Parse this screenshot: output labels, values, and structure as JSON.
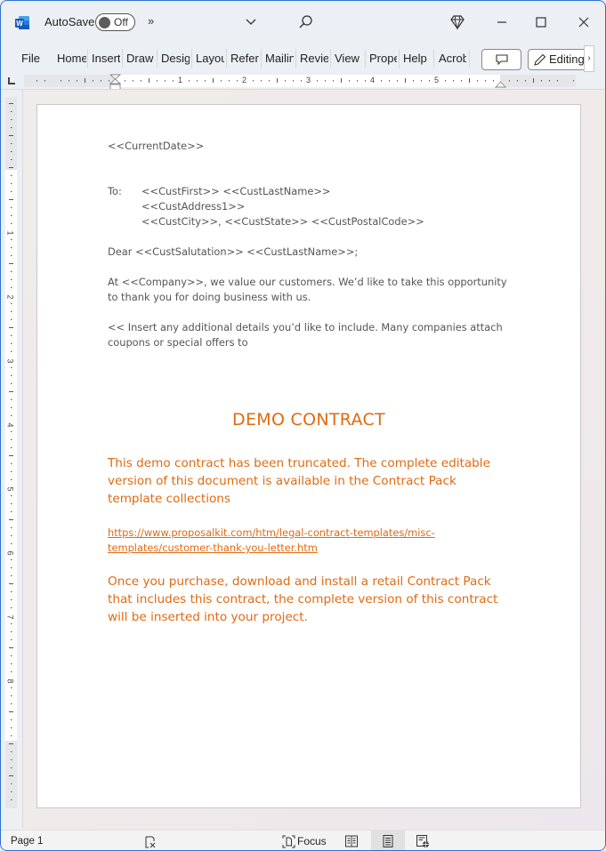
{
  "titlebar": {
    "app_icon": "word-icon",
    "autosave_label": "AutoSave",
    "autosave_state": "Off",
    "more_commands": "»",
    "icons": [
      "chevron-down-icon",
      "search-icon",
      "diamond-icon",
      "minimize-icon",
      "maximize-icon",
      "close-icon"
    ]
  },
  "ribbon": {
    "tabs": [
      {
        "label": "File"
      },
      {
        "label": "Home"
      },
      {
        "label": "Insert"
      },
      {
        "label": "Draw"
      },
      {
        "label": "Design"
      },
      {
        "label": "Layout"
      },
      {
        "label": "References"
      },
      {
        "label": "Mailings"
      },
      {
        "label": "Review"
      },
      {
        "label": "View"
      },
      {
        "label": "Properties"
      },
      {
        "label": "Help"
      },
      {
        "label": "Acrobat"
      }
    ],
    "comment_button": "comment-icon",
    "editing_label": "Editing",
    "scroll_label": "›"
  },
  "ruler": {
    "horizontal_numbers": [
      "1",
      "2",
      "3",
      "4",
      "5"
    ],
    "vertical_numbers": [
      "1",
      "2",
      "3",
      "4",
      "5",
      "6",
      "7",
      "8"
    ]
  },
  "document": {
    "date_field": "<<CurrentDate>>",
    "to_label": "To:",
    "address_lines": [
      "<<CustFirst>> <<CustLastName>>",
      "<<CustAddress1>>",
      "<<CustCity>>, <<CustState>> <<CustPostalCode>>"
    ],
    "salutation": "Dear <<CustSalutation>> <<CustLastName>>;",
    "para1_lines": [
      "At <<Company>>, we value our customers. We’d like to take this opportunity",
      "to thank you for doing business with us."
    ],
    "para2_lines": [
      "<< Insert any additional details you’d like to include. Many companies attach",
      "coupons or special offers to"
    ],
    "demo_title": "DEMO CONTRACT",
    "demo_para1_lines": [
      "This demo contract has been truncated. The complete editable",
      "version of this document is available in the Contract Pack",
      "template collections"
    ],
    "link_lines": [
      "https://www.proposalkit.com/htm/legal-contract-templates/misc-",
      "templates/customer-thank-you-letter.htm"
    ],
    "demo_para2_lines": [
      "Once you purchase, download and install a retail Contract Pack",
      "that includes this contract, the complete version of this contract",
      "will be inserted into your project."
    ],
    "accent_color": "#e06a12"
  },
  "statusbar": {
    "page_label": "Page 1",
    "focus_label": "Focus",
    "active_view": "Print Layout"
  }
}
